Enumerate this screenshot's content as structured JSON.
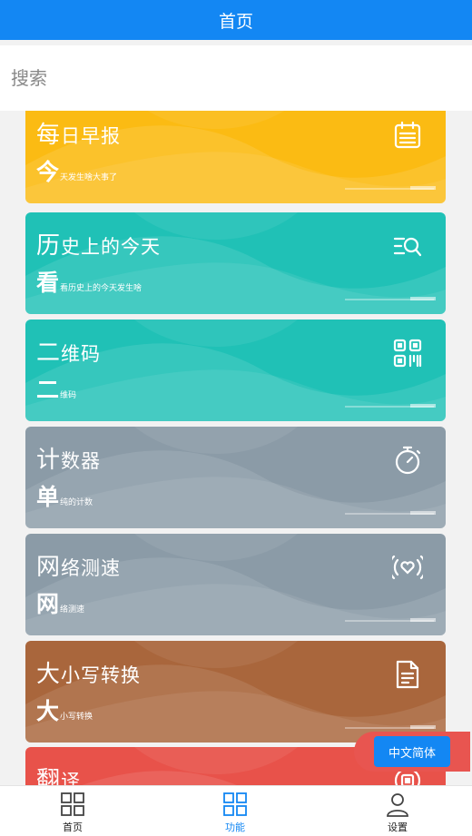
{
  "header": {
    "title": "首页"
  },
  "search": {
    "placeholder": "搜索",
    "value": ""
  },
  "cards": [
    {
      "title_first": "每",
      "title_rest": "日早报",
      "sub_big": "今",
      "sub_small": "天发生啥大事了",
      "icon": "calendar-icon",
      "color": "#fbbb13"
    },
    {
      "title_first": "历",
      "title_rest": "史上的今天",
      "sub_big": "看",
      "sub_small": "看历史上的今天发生啥",
      "icon": "list-search-icon",
      "color": "#20c1b6"
    },
    {
      "title_first": "二",
      "title_rest": "维码",
      "sub_big": "二",
      "sub_small": "维码",
      "icon": "qrcode-icon",
      "color": "#20c1b6"
    },
    {
      "title_first": "计",
      "title_rest": "数器",
      "sub_big": "单",
      "sub_small": "纯的计数",
      "icon": "stopwatch-icon",
      "color": "#8b9ba7"
    },
    {
      "title_first": "网",
      "title_rest": "络测速",
      "sub_big": "网",
      "sub_small": "络测速",
      "icon": "signal-heart-icon",
      "color": "#8b9ba7"
    },
    {
      "title_first": "大",
      "title_rest": "小写转换",
      "sub_big": "大",
      "sub_small": "小写转换",
      "icon": "document-icon",
      "color": "#a9663c"
    },
    {
      "title_first": "翻",
      "title_rest": "译",
      "sub_big": "",
      "sub_small": "",
      "icon": "translate-icon",
      "color": "#e8524a"
    }
  ],
  "language_button": {
    "label": "中文简体"
  },
  "tabbar": {
    "items": [
      {
        "label": "首页",
        "icon": "grid-icon",
        "active": false
      },
      {
        "label": "功能",
        "icon": "grid-icon",
        "active": true
      },
      {
        "label": "设置",
        "icon": "user-icon",
        "active": false
      }
    ]
  },
  "colors": {
    "primary": "#1387f3",
    "accent_red": "#e85550"
  }
}
